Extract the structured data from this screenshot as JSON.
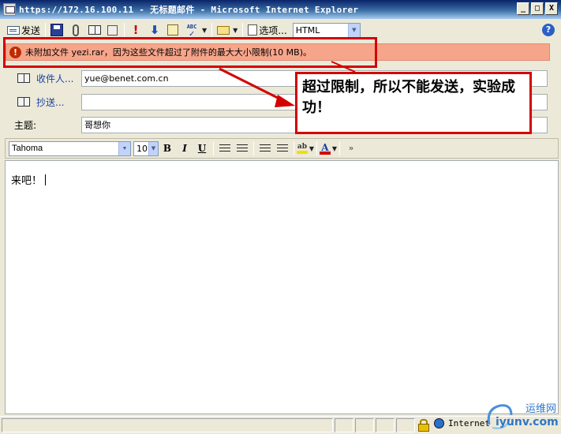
{
  "window": {
    "title": "https://172.16.100.11 - 无标题邮件 - Microsoft Internet Explorer",
    "buttons": [
      "_",
      "□",
      "X"
    ]
  },
  "toolbar": {
    "send_label": "发送",
    "options_label": "选项...",
    "format_value": "HTML",
    "help": "?"
  },
  "warning": {
    "icon": "!",
    "text": "未附加文件 yezi.rar，因为这些文件超过了附件的最大大小限制(10 MB)。"
  },
  "header": {
    "to_label": "收件人...",
    "to_value": "yue@benet.com.cn",
    "cc_label": "抄送...",
    "cc_value": "",
    "subject_label": "主题:",
    "subject_value": "哥想你"
  },
  "callout": {
    "text": "超过限制，所以不能发送，实验成功！"
  },
  "format": {
    "font": "Tahoma",
    "size": "10",
    "bold": "B",
    "italic": "I",
    "underline": "U",
    "highlight": "ab",
    "font_color": "A"
  },
  "body": {
    "text": "来吧！"
  },
  "statusbar": {
    "zone": "Internet"
  },
  "watermark": {
    "name": "运维网",
    "url": "iyunv.com"
  }
}
